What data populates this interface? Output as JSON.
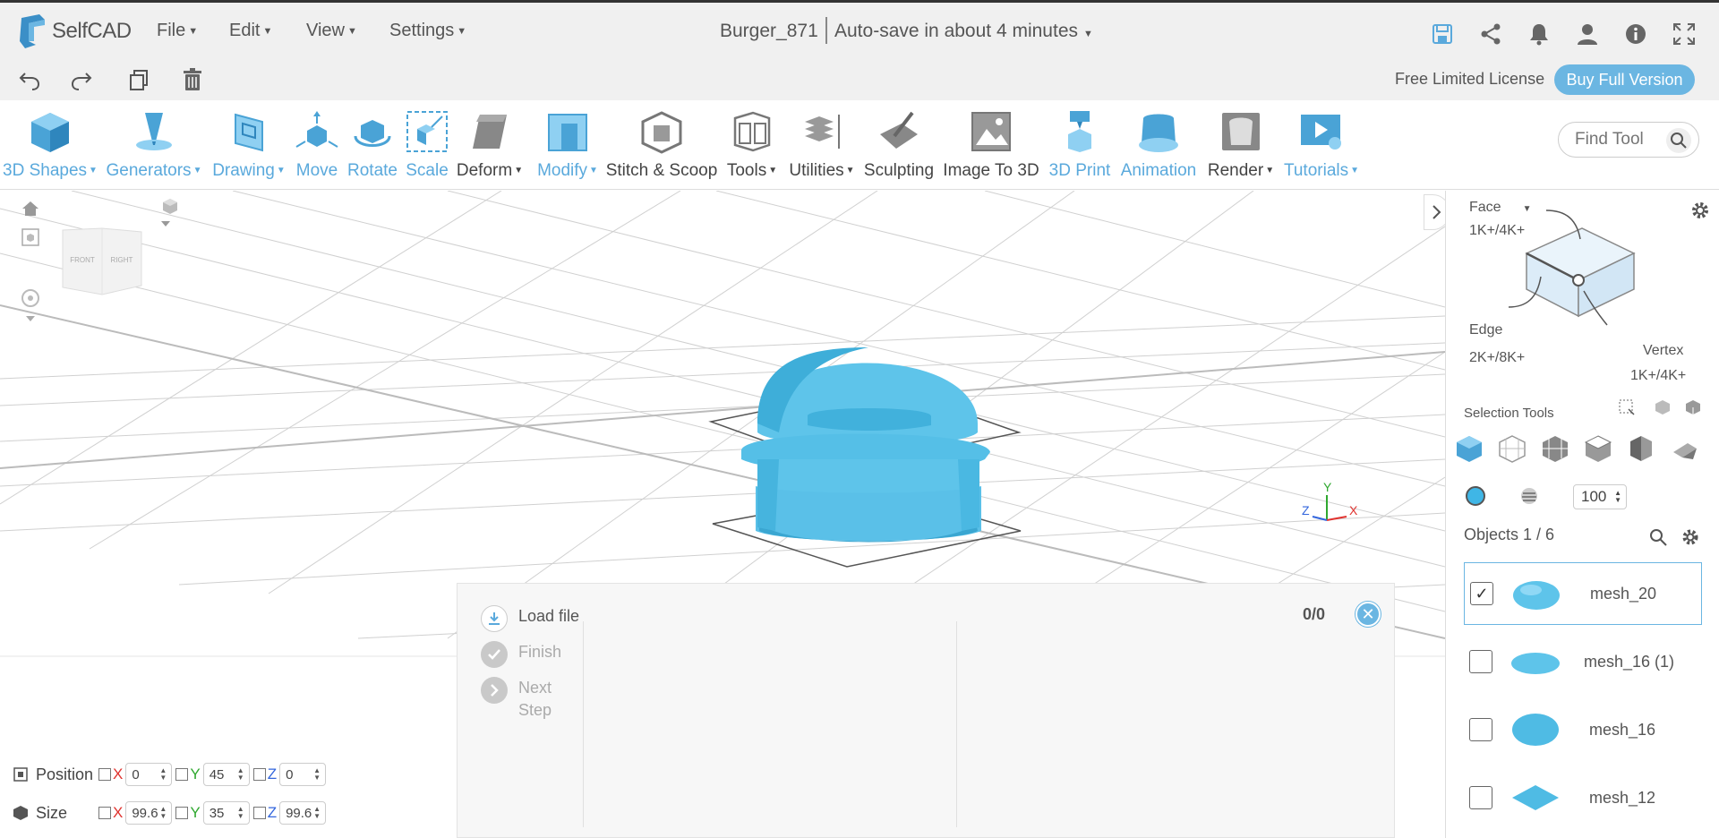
{
  "app": {
    "logo_text": "SelfCAD",
    "menus": [
      "File",
      "Edit",
      "View",
      "Settings"
    ],
    "document_title": "Burger_871",
    "autosave_text": "Auto-save in about 4 minutes",
    "top_icons": [
      "save-icon",
      "share-icon",
      "bell-icon",
      "user-icon",
      "info-icon",
      "fullscreen-icon"
    ]
  },
  "actionbar": {
    "icons": [
      "undo-icon",
      "redo-icon",
      "copy-icon",
      "trash-icon"
    ],
    "license_text": "Free Limited License",
    "buy_label": "Buy Full Version"
  },
  "toolbar": {
    "tools": [
      {
        "label": "3D Shapes",
        "dropdown": true,
        "color": "blue"
      },
      {
        "label": "Generators",
        "dropdown": true,
        "color": "blue"
      },
      {
        "label": "Drawing",
        "dropdown": true,
        "color": "blue"
      },
      {
        "label": "Move",
        "dropdown": false,
        "color": "blue"
      },
      {
        "label": "Rotate",
        "dropdown": false,
        "color": "blue"
      },
      {
        "label": "Scale",
        "dropdown": false,
        "color": "blue"
      },
      {
        "label": "Deform",
        "dropdown": true,
        "color": "dark"
      },
      {
        "label": "Modify",
        "dropdown": true,
        "color": "blue"
      },
      {
        "label": "Stitch & Scoop",
        "dropdown": false,
        "color": "dark"
      },
      {
        "label": "Tools",
        "dropdown": true,
        "color": "dark"
      },
      {
        "label": "Utilities",
        "dropdown": true,
        "color": "dark"
      },
      {
        "label": "Sculpting",
        "dropdown": false,
        "color": "dark"
      },
      {
        "label": "Image To 3D",
        "dropdown": false,
        "color": "dark"
      },
      {
        "label": "3D Print",
        "dropdown": false,
        "color": "blue"
      },
      {
        "label": "Animation",
        "dropdown": false,
        "color": "blue"
      },
      {
        "label": "Render",
        "dropdown": true,
        "color": "dark"
      },
      {
        "label": "Tutorials",
        "dropdown": true,
        "color": "blue"
      }
    ],
    "find_tool_placeholder": "Find Tool"
  },
  "viewport": {
    "viewcube_front": "FRONT",
    "viewcube_right": "RIGHT",
    "axes": {
      "x": "X",
      "y": "Y",
      "z": "Z"
    }
  },
  "steps_panel": {
    "steps": [
      "Load file",
      "Finish",
      "Next Step"
    ],
    "count": "0/0",
    "close": "✕"
  },
  "transform": {
    "position_label": "Position",
    "size_label": "Size",
    "position": {
      "x": "0",
      "y": "45",
      "z": "0"
    },
    "size": {
      "x": "99.6",
      "y": "35",
      "z": "99.6"
    }
  },
  "right_panel": {
    "face_label": "Face",
    "face_count": "1K+/4K+",
    "edge_label": "Edge",
    "edge_count": "2K+/8K+",
    "vertex_label": "Vertex",
    "vertex_count": "1K+/4K+",
    "selection_tools_label": "Selection Tools",
    "opacity_value": "100",
    "objects_header": "Objects 1 / 6",
    "objects": [
      {
        "name": "mesh_20",
        "checked": true
      },
      {
        "name": "mesh_16 (1)",
        "checked": false
      },
      {
        "name": "mesh_16",
        "checked": false
      },
      {
        "name": "mesh_12",
        "checked": false
      }
    ]
  },
  "colors": {
    "accent": "#6bb6e2",
    "mesh": "#5ec4ea",
    "toolbar_blue": "#5aa9dc"
  }
}
